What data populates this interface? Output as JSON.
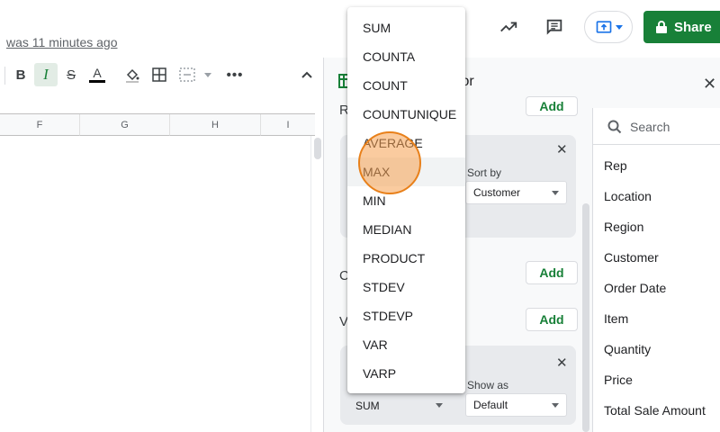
{
  "header": {
    "last_edit": "was 11 minutes ago",
    "share_label": "Share"
  },
  "toolbar": {
    "bold": "B",
    "italic": "I",
    "strike": "S",
    "text_color": "A"
  },
  "sheet": {
    "columns": [
      "F",
      "G",
      "H",
      "I"
    ]
  },
  "pivot_editor": {
    "title": "tor",
    "rows_label": "R",
    "columns_label": "C",
    "values_label": "V",
    "add_label": "Add",
    "sort_by_label": "Sort by",
    "sort_by_value": "Customer",
    "show_as_label": "Show as",
    "show_as_value": "Default",
    "summarize_value": "SUM"
  },
  "field_list": {
    "search_placeholder": "Search",
    "fields": [
      "Rep",
      "Location",
      "Region",
      "Customer",
      "Order Date",
      "Item",
      "Quantity",
      "Price",
      "Total Sale Amount"
    ]
  },
  "summarize_menu": {
    "items": [
      "SUM",
      "COUNTA",
      "COUNT",
      "COUNTUNIQUE",
      "AVERAGE",
      "MAX",
      "MIN",
      "MEDIAN",
      "PRODUCT",
      "STDEV",
      "STDEVP",
      "VAR",
      "VARP"
    ],
    "hovered": "MAX"
  },
  "colors": {
    "brand_green": "#188038",
    "accent_blue": "#1a73e8",
    "click_indicator": "#e8801a"
  }
}
